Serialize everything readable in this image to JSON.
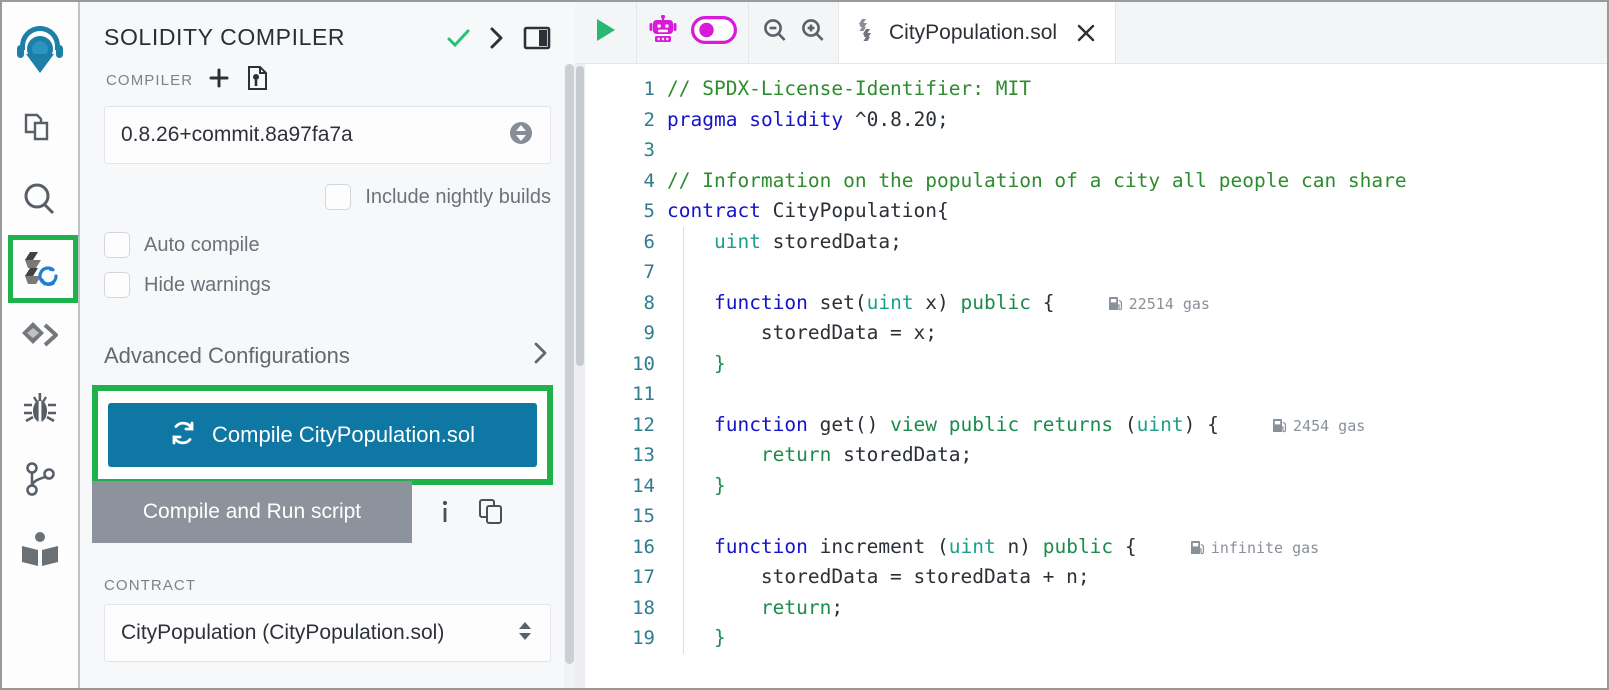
{
  "sidebar": {
    "items": [
      {
        "name": "remix-home-icon",
        "label": "Remix Home"
      },
      {
        "name": "file-explorer-icon",
        "label": "File explorer"
      },
      {
        "name": "search-icon",
        "label": "Search in files"
      },
      {
        "name": "solidity-compiler-icon",
        "label": "Solidity compiler"
      },
      {
        "name": "deploy-run-icon",
        "label": "Deploy & run transactions"
      },
      {
        "name": "debugger-icon",
        "label": "Debugger"
      },
      {
        "name": "git-branch-icon",
        "label": "Git"
      },
      {
        "name": "documentation-icon",
        "label": "Documentation"
      }
    ],
    "active_index": 3,
    "highlight_color": "#20b24a"
  },
  "panel": {
    "title": "SOLIDITY COMPILER",
    "title_actions": [
      {
        "name": "compile-success-check-icon",
        "glyph": "check",
        "color": "#29c07a"
      },
      {
        "name": "chevron-right-icon",
        "glyph": "chevron",
        "color": "#2c3037"
      },
      {
        "name": "panel-layout-icon",
        "glyph": "panel",
        "color": "#2c3037"
      }
    ],
    "compiler_section_label": "COMPILER",
    "compiler_actions": [
      {
        "name": "add-custom-compiler-icon",
        "glyph": "plus"
      },
      {
        "name": "compiler-config-file-icon",
        "glyph": "config-file"
      }
    ],
    "compiler_version": "0.8.26+commit.8a97fa7a",
    "checkboxes": [
      {
        "name": "include-nightly-builds-checkbox",
        "label": "Include nightly builds",
        "checked": false
      },
      {
        "name": "auto-compile-checkbox",
        "label": "Auto compile",
        "checked": false
      },
      {
        "name": "hide-warnings-checkbox",
        "label": "Hide warnings",
        "checked": false
      }
    ],
    "advanced_configurations_label": "Advanced Configurations",
    "compile_button_label": "Compile CityPopulation.sol",
    "compile_button_color": "#0e77a3",
    "compile_and_run_label": "Compile and Run script",
    "compile_and_run_color": "#8c939c",
    "run_actions": [
      {
        "name": "script-info-icon",
        "glyph": "info"
      },
      {
        "name": "copy-script-icon",
        "glyph": "copy"
      }
    ],
    "contract_section_label": "CONTRACT",
    "selected_contract": "CityPopulation (CityPopulation.sol)"
  },
  "editor": {
    "toolbar": [
      {
        "name": "run-script-play-icon",
        "glyph": "play",
        "color": "#2ab673"
      },
      {
        "name": "remix-ai-robot-icon",
        "glyph": "robot",
        "color": "#d91ad9"
      },
      {
        "name": "remix-ai-toggle",
        "glyph": "toggle-on",
        "color": "#d91ad9"
      },
      {
        "name": "zoom-out-icon",
        "glyph": "zoom-out",
        "color": "#5b6169"
      },
      {
        "name": "zoom-in-icon",
        "glyph": "zoom-in",
        "color": "#5b6169"
      }
    ],
    "tab": {
      "file_icon": "solidity-file-icon",
      "filename": "CityPopulation.sol",
      "close_label": "×"
    },
    "code": [
      {
        "num": "1",
        "tokens": [
          {
            "t": "// SPDX-License-Identifier: MIT",
            "c": "cm"
          }
        ]
      },
      {
        "num": "2",
        "tokens": [
          {
            "t": "pragma",
            "c": "k"
          },
          {
            "t": " ",
            "c": ""
          },
          {
            "t": "solidity",
            "c": "k"
          },
          {
            "t": " ^0.8.20;",
            "c": ""
          }
        ]
      },
      {
        "num": "3",
        "tokens": []
      },
      {
        "num": "4",
        "tokens": [
          {
            "t": "// Information on the population of a city all people can share",
            "c": "cm"
          }
        ]
      },
      {
        "num": "5",
        "tokens": [
          {
            "t": "contract",
            "c": "k"
          },
          {
            "t": " CityPopulation{",
            "c": ""
          }
        ]
      },
      {
        "num": "6",
        "tokens": [
          {
            "t": "    ",
            "c": ""
          },
          {
            "t": "uint",
            "c": "ty"
          },
          {
            "t": " storedData;",
            "c": ""
          }
        ]
      },
      {
        "num": "7",
        "tokens": []
      },
      {
        "num": "8",
        "tokens": [
          {
            "t": "    ",
            "c": ""
          },
          {
            "t": "function",
            "c": "k"
          },
          {
            "t": " set(",
            "c": ""
          },
          {
            "t": "uint",
            "c": "ty"
          },
          {
            "t": " x) ",
            "c": ""
          },
          {
            "t": "public",
            "c": "kg"
          },
          {
            "t": " {",
            "c": ""
          }
        ],
        "gas": "22514 gas"
      },
      {
        "num": "9",
        "tokens": [
          {
            "t": "        storedData = x;",
            "c": ""
          }
        ]
      },
      {
        "num": "10",
        "tokens": [
          {
            "t": "    }",
            "c": "kg"
          }
        ]
      },
      {
        "num": "11",
        "tokens": []
      },
      {
        "num": "12",
        "tokens": [
          {
            "t": "    ",
            "c": ""
          },
          {
            "t": "function",
            "c": "k"
          },
          {
            "t": " get() ",
            "c": ""
          },
          {
            "t": "view public returns",
            "c": "kg"
          },
          {
            "t": " (",
            "c": ""
          },
          {
            "t": "uint",
            "c": "ty"
          },
          {
            "t": ") {",
            "c": ""
          }
        ],
        "gas": "2454 gas"
      },
      {
        "num": "13",
        "tokens": [
          {
            "t": "        ",
            "c": ""
          },
          {
            "t": "return",
            "c": "kg"
          },
          {
            "t": " storedData;",
            "c": ""
          }
        ]
      },
      {
        "num": "14",
        "tokens": [
          {
            "t": "    }",
            "c": "kg"
          }
        ]
      },
      {
        "num": "15",
        "tokens": []
      },
      {
        "num": "16",
        "tokens": [
          {
            "t": "    ",
            "c": ""
          },
          {
            "t": "function",
            "c": "k"
          },
          {
            "t": " increment (",
            "c": ""
          },
          {
            "t": "uint",
            "c": "ty"
          },
          {
            "t": " n) ",
            "c": ""
          },
          {
            "t": "public",
            "c": "kg"
          },
          {
            "t": " {",
            "c": ""
          }
        ],
        "gas": "infinite gas"
      },
      {
        "num": "17",
        "tokens": [
          {
            "t": "        storedData = storedData + n;",
            "c": ""
          }
        ]
      },
      {
        "num": "18",
        "tokens": [
          {
            "t": "        ",
            "c": ""
          },
          {
            "t": "return",
            "c": "kg"
          },
          {
            "t": ";",
            "c": ""
          }
        ]
      },
      {
        "num": "19",
        "tokens": [
          {
            "t": "    }",
            "c": "kg"
          }
        ]
      }
    ]
  }
}
